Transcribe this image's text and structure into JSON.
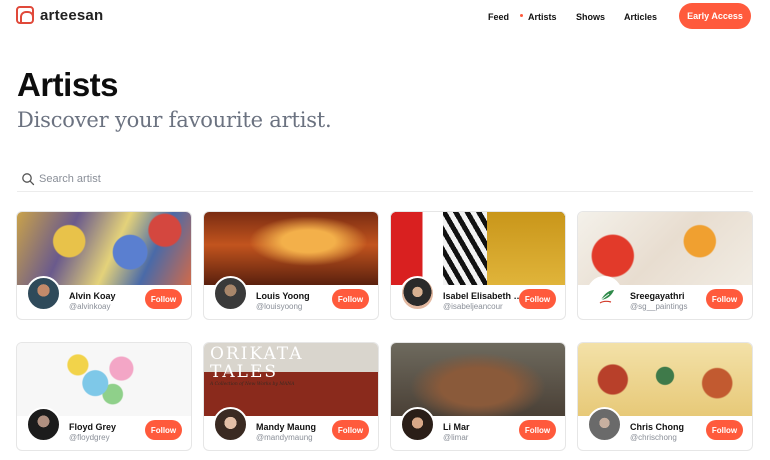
{
  "brand": {
    "name": "arteesan",
    "accent": "#ff5a3c"
  },
  "nav": {
    "links": [
      "Feed",
      "Artists",
      "Shows",
      "Articles"
    ],
    "active": "Artists",
    "cta": "Early Access"
  },
  "page": {
    "title": "Artists",
    "subtitle": "Discover your favourite artist."
  },
  "search": {
    "placeholder": "Search artist",
    "value": ""
  },
  "follow_label": "Follow",
  "artists": [
    {
      "name": "Alvin Koay",
      "handle": "@alvinkoay"
    },
    {
      "name": "Louis Yoong",
      "handle": "@louisyoong"
    },
    {
      "name": "Isabel Elisabeth Jean...",
      "handle": "@isabeljeancour"
    },
    {
      "name": "Sreegayathri",
      "handle": "@sg__paintings"
    },
    {
      "name": "Floyd Grey",
      "handle": "@floydgrey"
    },
    {
      "name": "Mandy Maung",
      "handle": "@mandymaung"
    },
    {
      "name": "Li Mar",
      "handle": "@limar"
    },
    {
      "name": "Chris Chong",
      "handle": "@chrischong"
    }
  ],
  "cover_text": {
    "orikata_title": "ORIKATA TALES",
    "orikata_sub": "A Collection of New Works by MANA"
  }
}
